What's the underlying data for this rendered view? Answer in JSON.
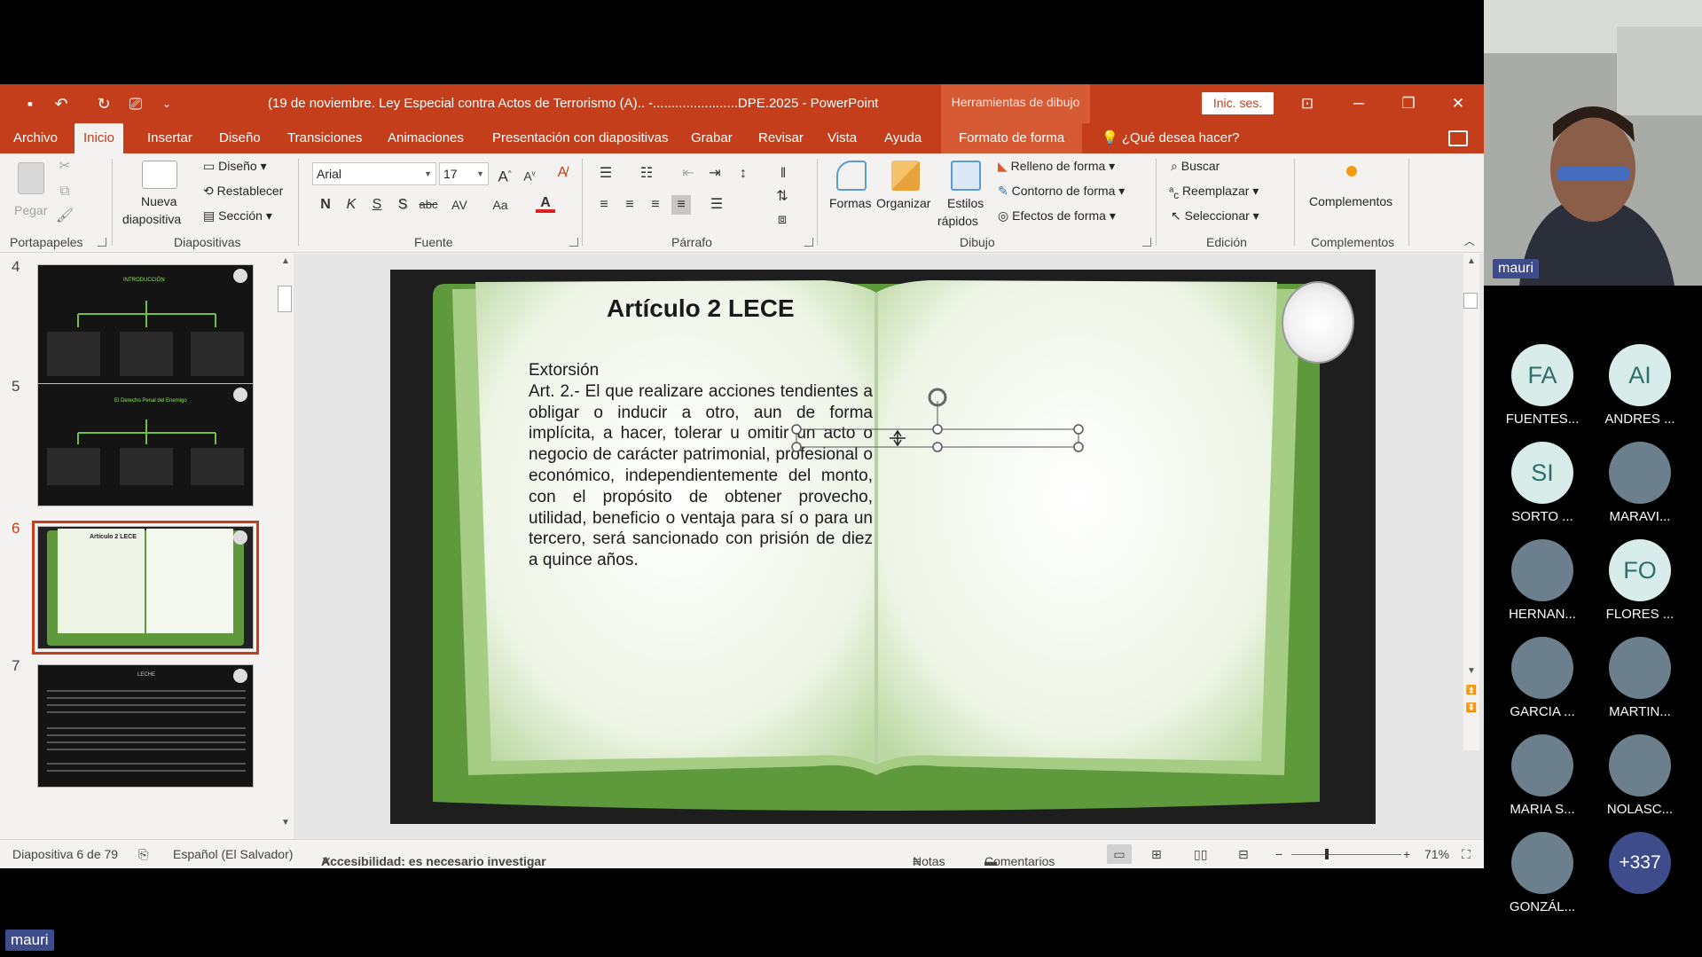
{
  "window": {
    "doc_title": "(19 de noviembre. Ley Especial contra Actos de Terrorismo (A).. -.......................DPE.2025  -  PowerPoint",
    "tools_context": "Herramientas de dibujo",
    "sign_in": "Inic. ses."
  },
  "tabs": [
    "Archivo",
    "Inicio",
    "Insertar",
    "Diseño",
    "Transiciones",
    "Animaciones",
    "Presentación con diapositivas",
    "Grabar",
    "Revisar",
    "Vista",
    "Ayuda",
    "Formato de forma"
  ],
  "tell_me": "¿Qué desea hacer?",
  "ribbon": {
    "clipboard": {
      "paste": "Pegar",
      "label": "Portapapeles"
    },
    "slides": {
      "new_slide_1": "Nueva",
      "new_slide_2": "diapositiva",
      "layout": "Diseño",
      "reset": "Restablecer",
      "section": "Sección",
      "label": "Diapositivas"
    },
    "font": {
      "family": "Arial",
      "size": "17",
      "bold": "N",
      "italic": "K",
      "underline": "S",
      "shadow": "S",
      "strike": "abc",
      "spacing": "AV",
      "case": "Aa",
      "color": "A",
      "label": "Fuente"
    },
    "paragraph": {
      "label": "Párrafo"
    },
    "drawing": {
      "shapes": "Formas",
      "arrange": "Organizar",
      "styles_1": "Estilos",
      "styles_2": "rápidos",
      "fill": "Relleno de forma",
      "outline": "Contorno de forma",
      "effects": "Efectos de forma",
      "label": "Dibujo"
    },
    "editing": {
      "find": "Buscar",
      "replace": "Reemplazar",
      "select": "Seleccionar",
      "label": "Edición"
    },
    "addins": {
      "button": "Complementos",
      "label": "Complementos"
    }
  },
  "thumbnails": [
    {
      "num": "4",
      "title": "INTRODUCCIÓN"
    },
    {
      "num": "5",
      "title": "El Derecho Penal del Enemigo"
    },
    {
      "num": "6",
      "title": "Artículo 2 LECE"
    },
    {
      "num": "7",
      "title": "LECHE"
    }
  ],
  "slide": {
    "title": "Artículo 2 LECE",
    "heading": "Extorsión",
    "body": "Art. 2.- El que realizare acciones tendientes a obligar o inducir a otro, aun de forma implícita, a hacer, tolerar u omitir un acto o negocio de carácter patrimonial, profesional o económico, independientemente del monto, con el propósito de obtener provecho, utilidad, beneficio o ventaja para sí o para un tercero, será sancionado con prisión de diez a quince años."
  },
  "status": {
    "slide_count": "Diapositiva 6 de 79",
    "language": "Español (El Salvador)",
    "accessibility": "Accesibilidad: es necesario investigar",
    "notes": "Notas",
    "comments": "Comentarios",
    "zoom": "71%"
  },
  "meeting": {
    "speaker": "mauri",
    "self_tag": "mauri",
    "participants": [
      {
        "initials": "FA",
        "name": "FUENTES...",
        "photo": false
      },
      {
        "initials": "AI",
        "name": "ANDRES ...",
        "photo": false
      },
      {
        "initials": "SI",
        "name": "SORTO ...",
        "photo": false
      },
      {
        "initials": "",
        "name": "MARAVI...",
        "photo": true
      },
      {
        "initials": "",
        "name": "HERNAN...",
        "photo": true
      },
      {
        "initials": "FO",
        "name": "FLORES ...",
        "photo": false
      },
      {
        "initials": "",
        "name": "GARCIA ...",
        "photo": true
      },
      {
        "initials": "",
        "name": "MARTIN...",
        "photo": true
      },
      {
        "initials": "",
        "name": "MARIA S...",
        "photo": true
      },
      {
        "initials": "",
        "name": "NOLASC...",
        "photo": true
      },
      {
        "initials": "",
        "name": "GONZÁL...",
        "photo": true
      }
    ],
    "more": "+337"
  },
  "colors": {
    "ppt_accent": "#c43e1c",
    "book_green": "#5e9a3c",
    "meeting_blue": "#3f4c8c"
  }
}
